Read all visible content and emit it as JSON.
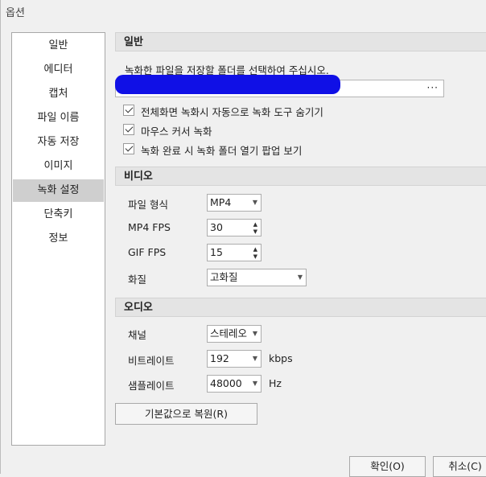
{
  "window": {
    "title": "옵션"
  },
  "sidebar": {
    "items": [
      {
        "label": "일반"
      },
      {
        "label": "에디터"
      },
      {
        "label": "캡처"
      },
      {
        "label": "파일 이름"
      },
      {
        "label": "자동 저장"
      },
      {
        "label": "이미지"
      },
      {
        "label": "녹화 설정",
        "selected": true
      },
      {
        "label": "단축키"
      },
      {
        "label": "정보"
      }
    ]
  },
  "general": {
    "heading": "일반",
    "instruction": "녹화한 파일을 저장할 폴더를 선택하여 주십시오.",
    "browse_label": "···",
    "checkboxes": [
      {
        "label": "전체화면 녹화시 자동으로 녹화 도구 숨기기",
        "checked": true
      },
      {
        "label": "마우스 커서 녹화",
        "checked": true
      },
      {
        "label": "녹화 완료 시 녹화 폴더 열기 팝업 보기",
        "checked": true
      }
    ]
  },
  "video": {
    "heading": "비디오",
    "format_label": "파일 형식",
    "format_value": "MP4",
    "mp4fps_label": "MP4 FPS",
    "mp4fps_value": "30",
    "giffps_label": "GIF FPS",
    "giffps_value": "15",
    "quality_label": "화질",
    "quality_value": "고화질"
  },
  "audio": {
    "heading": "오디오",
    "channel_label": "채널",
    "channel_value": "스테레오",
    "bitrate_label": "비트레이트",
    "bitrate_value": "192",
    "bitrate_unit": "kbps",
    "samplerate_label": "샘플레이트",
    "samplerate_value": "48000",
    "samplerate_unit": "Hz"
  },
  "buttons": {
    "reset": "기본값으로 복원(R)",
    "ok": "확인(O)",
    "cancel": "취소(C)"
  },
  "icons": {
    "combo_arrow": "chevron-down-icon",
    "spin_up": "caret-up-icon",
    "spin_down": "caret-down-icon"
  },
  "colors": {
    "selected_item": "#cfcfcf",
    "section_header": "#e4e4e4",
    "redaction": "#1010e6"
  }
}
